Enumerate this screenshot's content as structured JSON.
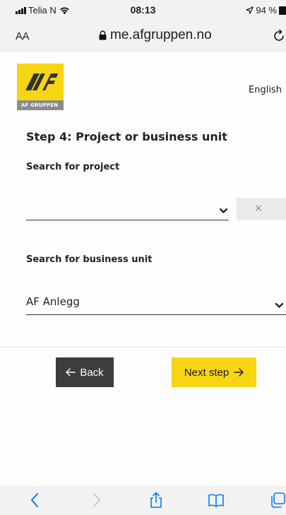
{
  "status_bar": {
    "carrier": "Telia N",
    "time": "08:13",
    "battery": "94 %"
  },
  "url_bar": {
    "aa_label": "AA",
    "url": "me.afgruppen.no"
  },
  "header": {
    "logo_text": "AF GRUPPEN",
    "language": "English"
  },
  "form": {
    "step_title": "Step 4: Project or business unit",
    "project_label": "Search for project",
    "project_value": "",
    "clear_label": "×",
    "unit_label": "Search for business unit",
    "unit_value": "AF Anlegg"
  },
  "actions": {
    "back_label": "Back",
    "next_label": "Next step"
  },
  "colors": {
    "brand_yellow": "#f7d515",
    "back_button": "#3d3d3d",
    "ios_blue": "#007aff"
  },
  "toolbar": {
    "icons": [
      "back-icon",
      "forward-icon",
      "share-icon",
      "bookmarks-icon",
      "tabs-icon"
    ]
  }
}
